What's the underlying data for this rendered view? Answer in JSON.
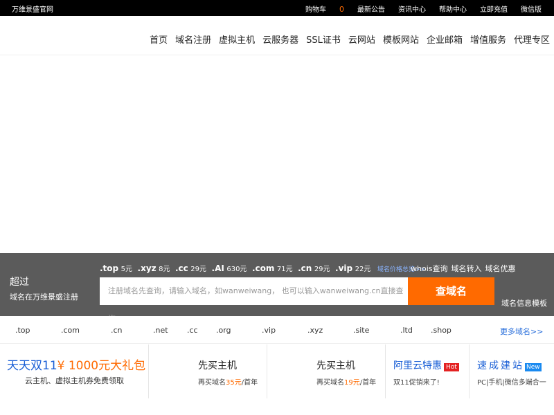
{
  "topbar": {
    "brand": "万维景盛官网",
    "cart_label": "购物车",
    "cart_count": "0",
    "links": [
      "最新公告",
      "资讯中心",
      "帮助中心",
      "立即充值",
      "微信版"
    ]
  },
  "nav": {
    "items": [
      "首页",
      "域名注册",
      "虚拟主机",
      "云服务器",
      "SSL证书",
      "云网站",
      "模板网站",
      "企业邮箱",
      "增值服务",
      "代理专区"
    ]
  },
  "search": {
    "title": "超过",
    "subtitle": "域名在万维景盛注册",
    "prices": [
      {
        "tld": ".top",
        "price": "5元"
      },
      {
        "tld": ".xyz",
        "price": "8元"
      },
      {
        "tld": ".cc",
        "price": "29元"
      },
      {
        "tld": ".AI",
        "price": "630元"
      },
      {
        "tld": ".com",
        "price": "71元"
      },
      {
        "tld": ".cn",
        "price": "29元"
      },
      {
        "tld": ".vip",
        "price": "22元"
      }
    ],
    "price_overview_link": "域名价格总览>>",
    "links": [
      "whois查询",
      "域名转入",
      "域名优惠"
    ],
    "placeholder": "注册域名先查询，请输入域名，如wanweiwang， 也可以输入wanweiwang.cn直接查询",
    "button": "查域名",
    "template_link": "域名信息模板"
  },
  "tld_strip": {
    "items": [
      ".top",
      ".com",
      ".cn",
      ".net",
      ".cc",
      ".org",
      ".vip",
      ".xyz",
      ".site",
      ".ltd",
      ".shop"
    ],
    "more": "更多域名>>"
  },
  "promos": {
    "p1": {
      "big_blue": "天天双11",
      "big_orange": "¥ 1000元大礼包",
      "sub": "云主机、虚拟主机券免费领取"
    },
    "p2": {
      "title": "先买主机",
      "sub_pre": "再买域名",
      "sub_hl": "35元",
      "sub_post": "/首年"
    },
    "p3": {
      "title": "先买主机",
      "sub_pre": "再买域名",
      "sub_hl": "19元",
      "sub_post": "/首年"
    },
    "p4": {
      "title": "阿里云特惠",
      "badge": "Hot",
      "sub": "双11促销来了!"
    },
    "p5": {
      "title": "速成建站",
      "badge": "New",
      "sub": "PC|手机|微信多端合一"
    }
  },
  "colors": {
    "accent": "#ff6a00",
    "link_blue": "#1a5fd6",
    "panel_gray": "#5b5b5b"
  }
}
